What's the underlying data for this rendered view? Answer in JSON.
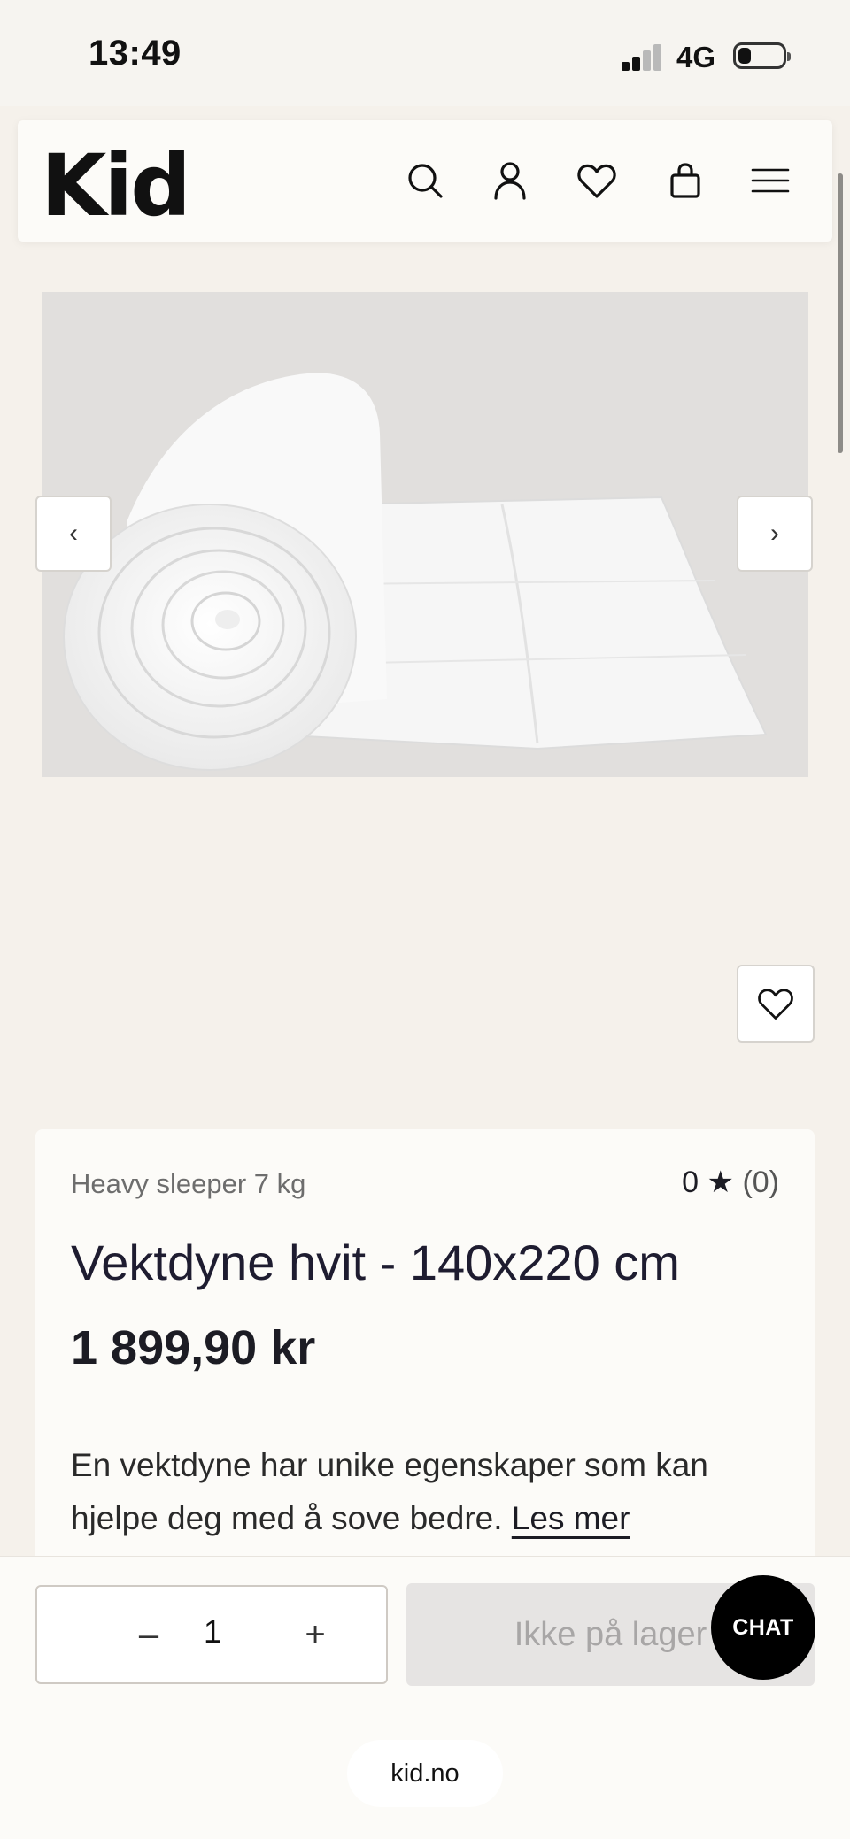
{
  "status_bar": {
    "time": "13:49",
    "network": "4G"
  },
  "header": {
    "logo": "Kid"
  },
  "gallery": {
    "prev_label": "‹",
    "next_label": "›"
  },
  "product": {
    "brand": "Heavy sleeper 7 kg",
    "rating_value": "0",
    "rating_star": "★",
    "rating_count": "(0)",
    "title": "Vektdyne hvit - 140x220 cm",
    "price": "1 899,90 kr",
    "description": "En vektdyne har unike egenskaper som kan hjelpe deg med å sove bedre. ",
    "read_more": "Les mer"
  },
  "cart": {
    "minus": "–",
    "quantity": "1",
    "plus": "+",
    "stock_label": "Ikke på lager"
  },
  "chat": {
    "label": "CHAT"
  },
  "browser": {
    "url": "kid.no"
  }
}
